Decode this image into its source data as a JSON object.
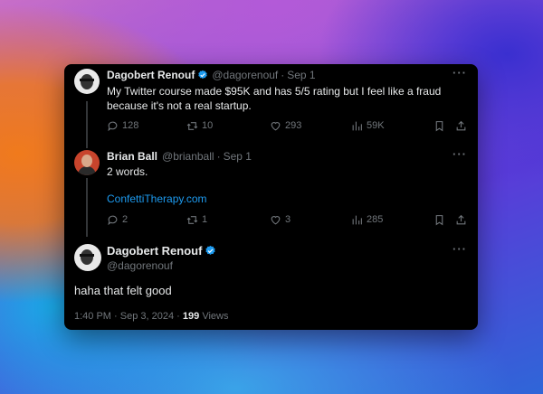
{
  "tweet1": {
    "name": "Dagobert Renouf",
    "handle": "@dagorenouf",
    "sep": "·",
    "date": "Sep 1",
    "text": "My Twitter course made $95K and has 5/5 rating but I feel like a fraud because it's not a real startup.",
    "replies": "128",
    "retweets": "10",
    "likes": "293",
    "views": "59K"
  },
  "tweet2": {
    "name": "Brian Ball",
    "handle": "@brianball",
    "sep": "·",
    "date": "Sep 1",
    "text": "2 words.",
    "link": "ConfettiTherapy.com",
    "replies": "2",
    "retweets": "1",
    "likes": "3",
    "views": "285"
  },
  "tweet3": {
    "name": "Dagobert Renouf",
    "handle": "@dagorenouf",
    "text": "haha that felt good",
    "time": "1:40 PM",
    "sep": "·",
    "date": "Sep 3, 2024",
    "sep2": "·",
    "views_count": "199",
    "views_label": "Views"
  },
  "more_label": "···",
  "icons": {
    "reply": "reply-icon",
    "retweet": "retweet-icon",
    "like": "heart-icon",
    "views": "views-icon",
    "bookmark": "bookmark-icon",
    "share": "share-icon",
    "verified": "verified-badge-icon"
  },
  "colors": {
    "card_bg": "#000000",
    "text": "#e7e9ea",
    "muted": "#71767b",
    "link": "#1d9bf0",
    "verified": "#1d9bf0"
  }
}
